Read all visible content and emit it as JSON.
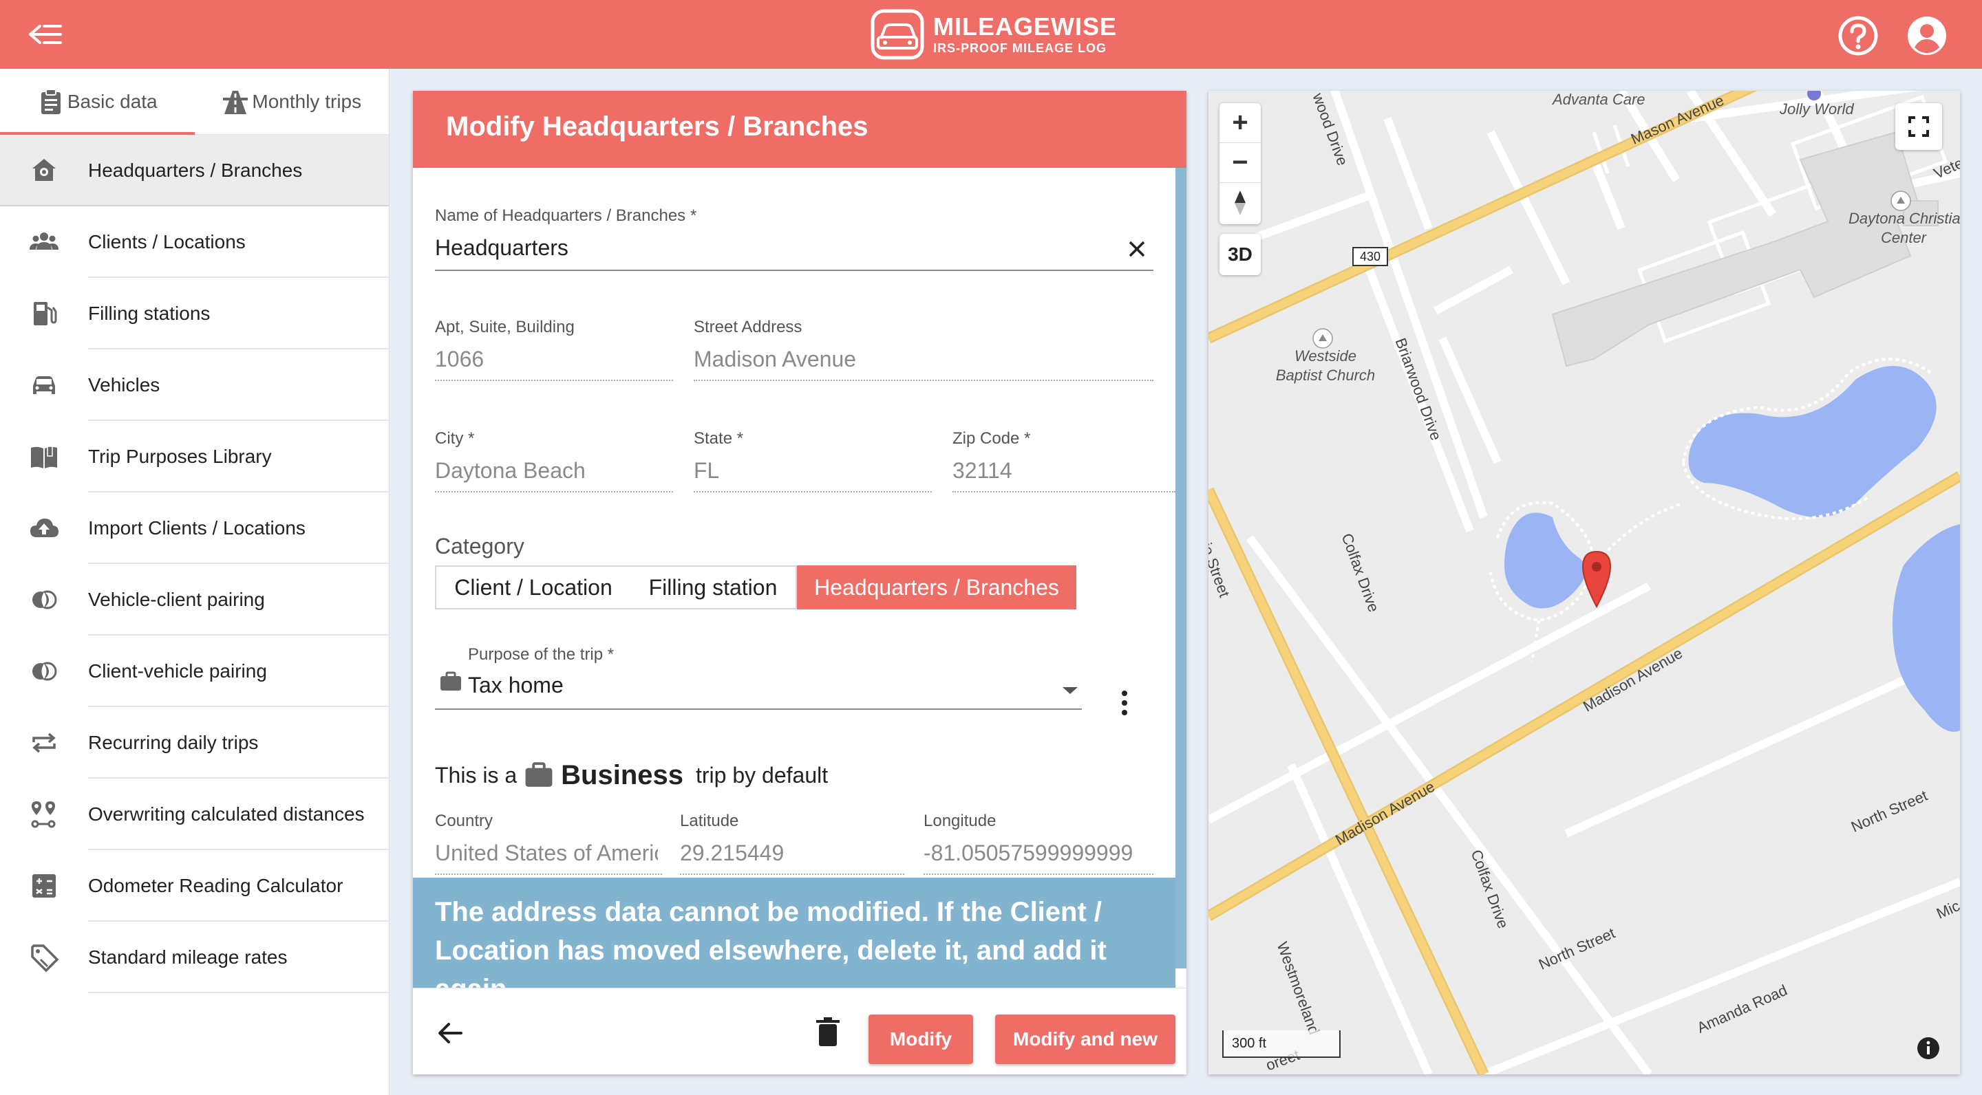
{
  "app": {
    "title": "MILEAGEWISE",
    "subtitle": "IRS-PROOF MILEAGE LOG"
  },
  "colors": {
    "brand": "#ee6e67",
    "notice": "#83b4cf",
    "water": "#9bb4f3",
    "major_road": "#f6d27a"
  },
  "tabs": [
    {
      "label": "Basic data",
      "icon": "clipboard-icon",
      "active": true
    },
    {
      "label": "Monthly trips",
      "icon": "road-icon",
      "active": false
    }
  ],
  "menu": [
    {
      "label": "Headquarters / Branches",
      "icon": "home-pin-icon",
      "active": true
    },
    {
      "label": "Clients / Locations",
      "icon": "people-icon"
    },
    {
      "label": "Filling stations",
      "icon": "fuel-pump-icon"
    },
    {
      "label": "Vehicles",
      "icon": "car-icon"
    },
    {
      "label": "Trip Purposes Library",
      "icon": "book-icon"
    },
    {
      "label": "Import Clients / Locations",
      "icon": "cloud-upload-icon"
    },
    {
      "label": "Vehicle-client pairing",
      "icon": "pairing-icon"
    },
    {
      "label": "Client-vehicle pairing",
      "icon": "pairing-icon"
    },
    {
      "label": "Recurring daily trips",
      "icon": "repeat-icon"
    },
    {
      "label": "Overwriting calculated distances",
      "icon": "route-pins-icon"
    },
    {
      "label": "Odometer Reading Calculator",
      "icon": "calculator-icon"
    },
    {
      "label": "Standard mileage rates",
      "icon": "price-tag-icon"
    }
  ],
  "form": {
    "title": "Modify Headquarters / Branches",
    "name": {
      "label": "Name of Headquarters / Branches *",
      "value": "Headquarters"
    },
    "apt": {
      "label": "Apt, Suite, Building",
      "value": "1066"
    },
    "street": {
      "label": "Street Address",
      "value": "Madison Avenue"
    },
    "city": {
      "label": "City *",
      "value": "Daytona Beach"
    },
    "state": {
      "label": "State *",
      "value": "FL"
    },
    "zip": {
      "label": "Zip Code *",
      "value": "32114"
    },
    "category": {
      "label": "Category",
      "options": [
        "Client / Location",
        "Filling station",
        "Headquarters / Branches"
      ],
      "selected": 2
    },
    "purpose": {
      "label": "Purpose of the trip *",
      "value": "Tax home"
    },
    "trip_type": {
      "prefix": "This is a",
      "type": "Business",
      "suffix": "trip by default"
    },
    "country": {
      "label": "Country",
      "value": "United States of America"
    },
    "latitude": {
      "label": "Latitude",
      "value": "29.215449"
    },
    "longitude": {
      "label": "Longitude",
      "value": "-81.05057599999999"
    },
    "notice": "The address data cannot be modified. If the Client / Location has moved elsewhere, delete it, and add it again",
    "buttons": {
      "modify": "Modify",
      "modify_new": "Modify and new"
    }
  },
  "map": {
    "zoom_in": "+",
    "zoom_out": "−",
    "mode_3d": "3D",
    "scale": "300 ft",
    "route_shield": "430",
    "places": [
      {
        "name": "Advanta Care",
        "lines": [
          "Advanta Care"
        ]
      },
      {
        "name": "Jolly World",
        "lines": [
          "Jolly World"
        ]
      },
      {
        "name": "Daytona Christian Center",
        "lines": [
          "Daytona Christian",
          "Center"
        ]
      },
      {
        "name": "Westside Baptist Church",
        "lines": [
          "Westside",
          "Baptist Church"
        ]
      }
    ],
    "streets": {
      "mason": "Mason Avenue",
      "vetera": "Vetera",
      "wood_drive": "wood Drive",
      "briarwood": "Briarwood Drive",
      "colfax_upper": "Colfax Drive",
      "colfax_lower": "Colfax Drive",
      "madison_upper": "Madison Avenue",
      "madison_lower": "Madison Avenue",
      "ie_street": "ie Street",
      "north_upper": "North Street",
      "north_lower": "North Street",
      "westmoreland": "Westmoreland",
      "amanda": "Amanda Road",
      "mic": "Mic",
      "oreet": "oreet"
    }
  }
}
